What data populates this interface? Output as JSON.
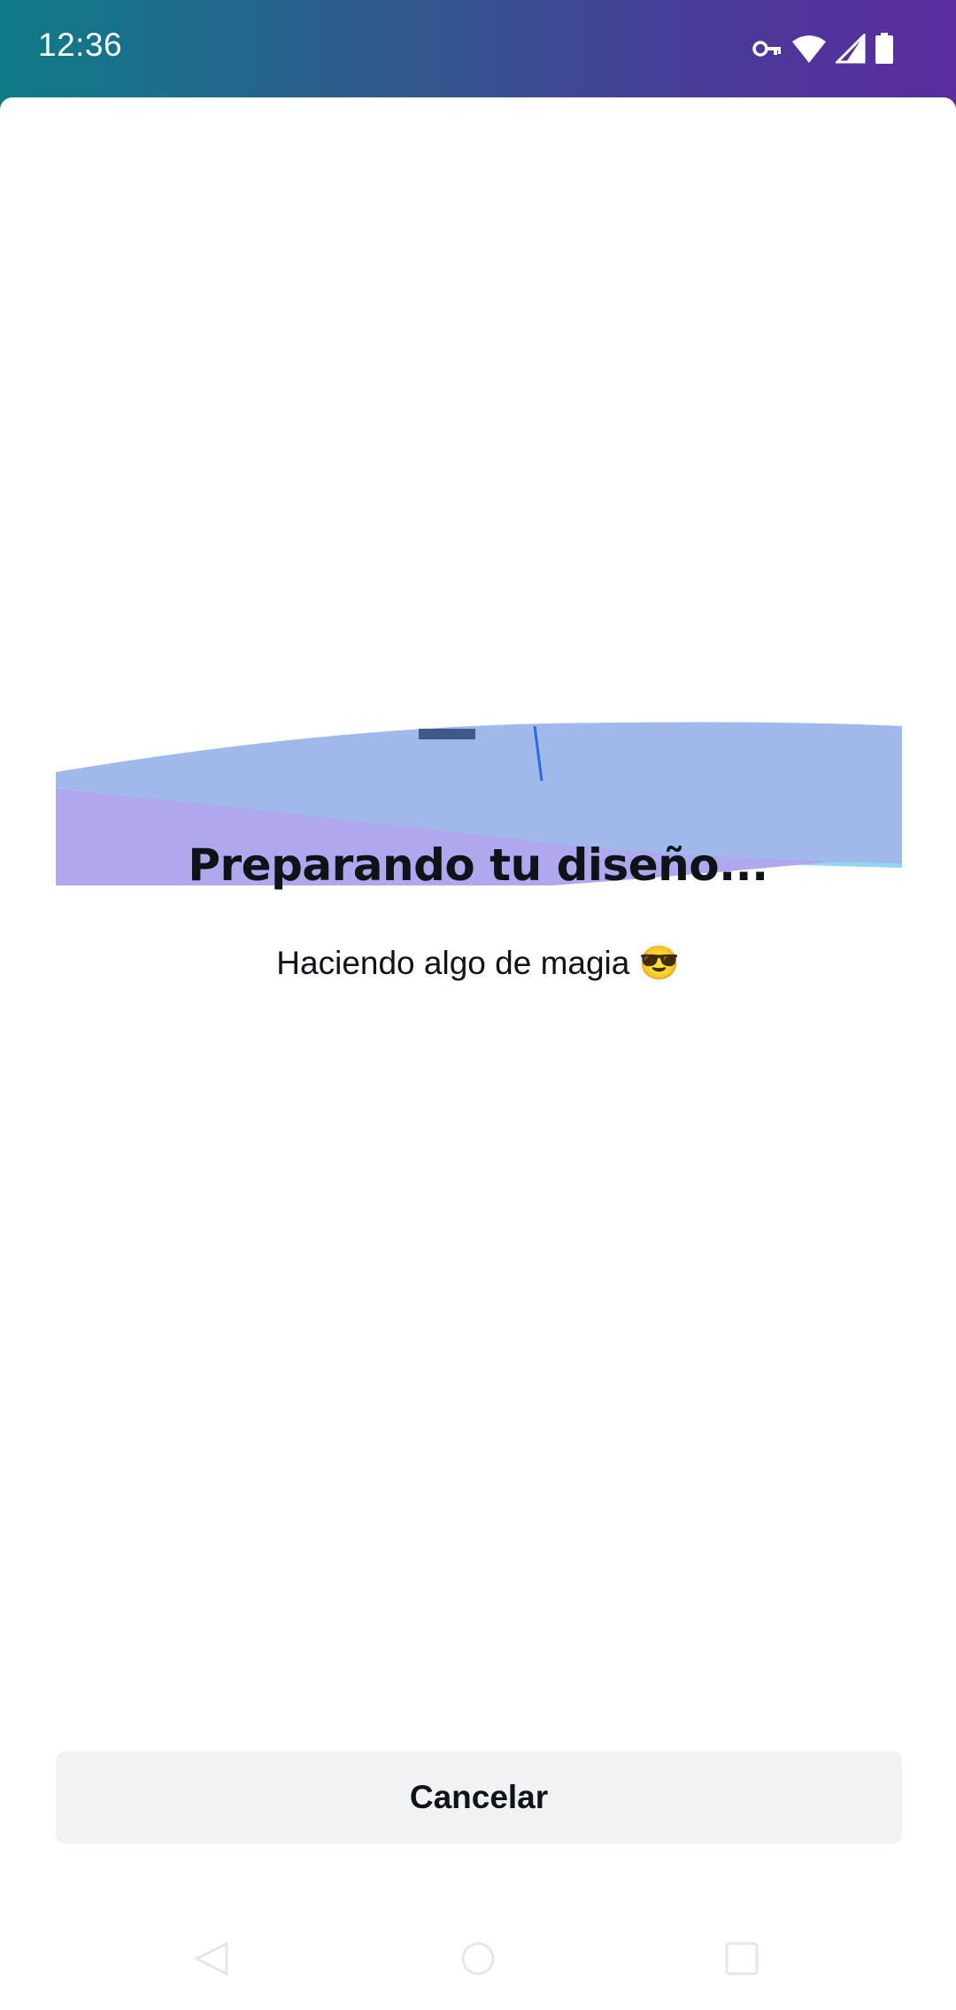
{
  "status_bar": {
    "time": "12:36",
    "icons": [
      "vpn-key-icon",
      "wifi-icon",
      "cell-signal-icon",
      "battery-icon"
    ]
  },
  "main": {
    "title": "Preparando tu diseño...",
    "subtitle": "Haciendo algo de magia 😎"
  },
  "actions": {
    "cancel_label": "Cancelar"
  },
  "nav": {
    "icons": [
      "back-icon",
      "home-icon",
      "recents-icon"
    ]
  },
  "colors": {
    "status_gradient_start": "#0f7b88",
    "status_gradient_end": "#5a2c9e",
    "wave_blue": "#9fb9ea",
    "wave_purple": "#afa8ef",
    "wave_cyan": "#8fd6ef",
    "button_bg": "#f1f2f4",
    "text": "#0e1318"
  }
}
